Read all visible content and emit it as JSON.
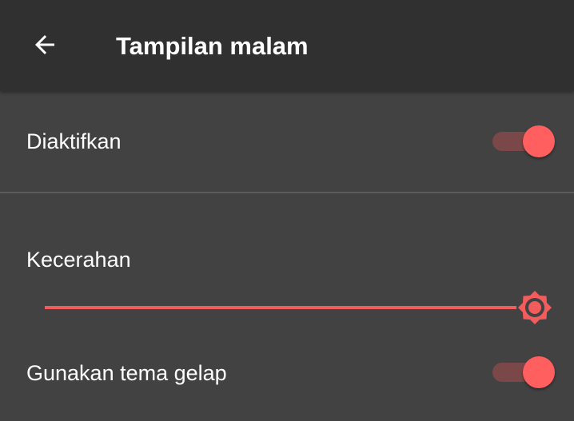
{
  "app_bar": {
    "title": "Tampilan malam",
    "back_icon": "arrow-left-icon"
  },
  "settings": {
    "enabled": {
      "label": "Diaktifkan",
      "checked": true
    },
    "brightness": {
      "label": "Kecerahan",
      "value_fraction": 1.0,
      "thumb_icon": "brightness-icon"
    },
    "dark_theme": {
      "label": "Gunakan tema gelap",
      "checked": true
    }
  },
  "colors": {
    "accent": "#ff5f5f",
    "app_bar_bg": "#303030",
    "background": "#424242",
    "toggle_track": "#7a4848",
    "divider": "#5c5c5c"
  }
}
